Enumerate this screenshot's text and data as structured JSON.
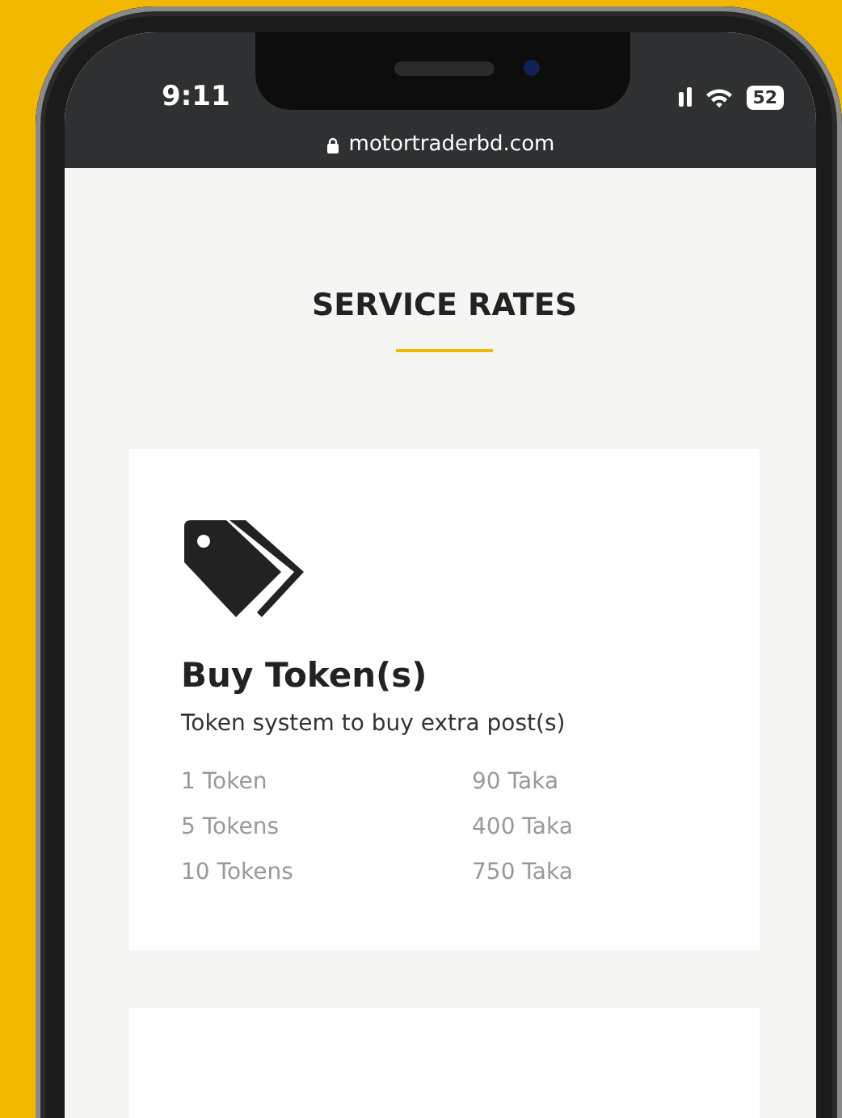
{
  "status_bar": {
    "time": "9:11",
    "battery": "52"
  },
  "address_bar": {
    "url": "motortraderbd.com"
  },
  "page": {
    "heading": "SERVICE RATES"
  },
  "cards": [
    {
      "title": "Buy Token(s)",
      "description": "Token system to buy extra post(s)",
      "rates": [
        {
          "quantity": "1 Token",
          "price": "90 Taka"
        },
        {
          "quantity": "5 Tokens",
          "price": "400 Taka"
        },
        {
          "quantity": "10 Tokens",
          "price": "750 Taka"
        }
      ]
    }
  ]
}
